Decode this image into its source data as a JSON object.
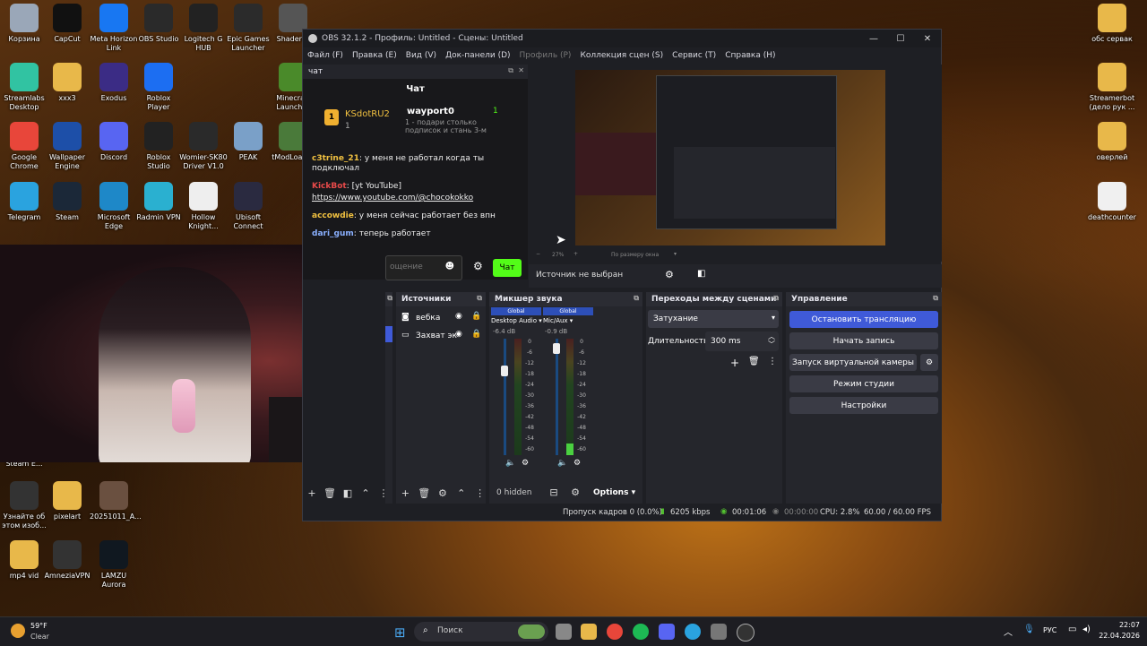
{
  "desktop": {
    "icons_left": [
      {
        "label": "Корзина",
        "icon": "recycle-bin-icon",
        "color": "#9aa7b8"
      },
      {
        "label": "CapCut",
        "icon": "capcut-icon",
        "color": "#111111"
      },
      {
        "label": "Meta Horizon Link",
        "icon": "meta-icon",
        "color": "#1877f2"
      },
      {
        "label": "OBS Studio",
        "icon": "obs-icon",
        "color": "#2a2a2a"
      },
      {
        "label": "Logitech G HUB",
        "icon": "logitech-icon",
        "color": "#222222"
      },
      {
        "label": "Epic Games Launcher",
        "icon": "epic-icon",
        "color": "#2b2b2b"
      },
      {
        "label": "ShaderGl",
        "icon": "shader-icon",
        "color": "#555555"
      },
      {
        "label": "Streamlabs Desktop",
        "icon": "streamlabs-icon",
        "color": "#31c3a2"
      },
      {
        "label": "xxx3",
        "icon": "folder-icon",
        "color": "#e8b84a"
      },
      {
        "label": "Exodus",
        "icon": "exodus-icon",
        "color": "#3b2c85"
      },
      {
        "label": "Roblox Player",
        "icon": "roblox-icon",
        "color": "#1c6ef2"
      },
      {
        "label": "Minecraft Launcher",
        "icon": "minecraft-icon",
        "color": "#4a8a2a"
      },
      {
        "label": "Google Chrome",
        "icon": "chrome-icon",
        "color": "#e8463a"
      },
      {
        "label": "Wallpaper Engine",
        "icon": "wallpaper-engine-icon",
        "color": "#1d4fa8"
      },
      {
        "label": "Discord",
        "icon": "discord-icon",
        "color": "#5865f2"
      },
      {
        "label": "Roblox Studio",
        "icon": "roblox-studio-icon",
        "color": "#222222"
      },
      {
        "label": "Womier-SK80 Driver V1.0",
        "icon": "womier-icon",
        "color": "#2a2a2a"
      },
      {
        "label": "PEAK",
        "icon": "peak-icon",
        "color": "#7aa0c8"
      },
      {
        "label": "tModLoader",
        "icon": "tmodloader-icon",
        "color": "#4a7a3a"
      },
      {
        "label": "Telegram",
        "icon": "telegram-icon",
        "color": "#2aa3df"
      },
      {
        "label": "Steam",
        "icon": "steam-icon",
        "color": "#1b2838"
      },
      {
        "label": "Microsoft Edge",
        "icon": "edge-icon",
        "color": "#1e88c8"
      },
      {
        "label": "Radmin VPN",
        "icon": "radmin-icon",
        "color": "#2ab0d0"
      },
      {
        "label": "Hollow Knight...",
        "icon": "hollow-knight-icon",
        "color": "#eeeeee"
      },
      {
        "label": "Ubisoft Connect",
        "icon": "ubisoft-icon",
        "color": "#2a2a40"
      },
      {
        "label": "Steam E...",
        "icon": "steam-e-icon",
        "color": "#1b2838"
      },
      {
        "label": "Узнайте об этом изоб...",
        "icon": "spotlight-icon",
        "color": "#333333"
      },
      {
        "label": "pixelart",
        "icon": "folder-icon",
        "color": "#e8b84a"
      },
      {
        "label": "20251011_A...",
        "icon": "image-file-icon",
        "color": "#6a5040"
      },
      {
        "label": "mp4 vid",
        "icon": "folder-icon",
        "color": "#e8b84a"
      },
      {
        "label": "AmneziaVPN",
        "icon": "amnezia-icon",
        "color": "#333333"
      },
      {
        "label": "LAMZU Aurora",
        "icon": "lamzu-icon",
        "color": "#101820"
      }
    ],
    "icons_right": [
      {
        "label": "обс сервак",
        "icon": "folder-icon",
        "color": "#e8b84a"
      },
      {
        "label": "Streamerbot (дело рук ...",
        "icon": "folder-icon",
        "color": "#e8b84a"
      },
      {
        "label": "оверлей",
        "icon": "folder-icon",
        "color": "#e8b84a"
      },
      {
        "label": "deathcounter",
        "icon": "text-file-icon",
        "color": "#f0f0f0"
      }
    ]
  },
  "obs": {
    "title": "OBS 32.1.2 - Профиль: Untitled - Сцены: Untitled",
    "menu": [
      "Файл (F)",
      "Правка (E)",
      "Вид (V)",
      "Док-панели (D)",
      "Профиль (P)",
      "Коллекция сцен (S)",
      "Сервис (T)",
      "Справка (H)"
    ],
    "chat": {
      "dock_title": "чат",
      "header": "Чат",
      "top_user": "KSdotRU2",
      "top_user_count": "1",
      "top_user2": "wayport0",
      "top_user2_count": "1",
      "gift_text": "1 - подари столько подписок и стань 3-м",
      "messages": [
        {
          "user": "c3trine_21",
          "user_color": "#f0c040",
          "text": "у меня не работал когда ты подключал"
        },
        {
          "user": "KickBot",
          "user_color": "#e84a4a",
          "text": "[yt YouTube]"
        },
        {
          "user": "",
          "user_color": "#ffffff",
          "text": "https://www.youtube.com/@chocokokko"
        },
        {
          "user": "accowdie",
          "user_color": "#f0c040",
          "text": "у меня сейчас работает без впн"
        },
        {
          "user": "dari_gum",
          "user_color": "#8ab0ff",
          "text": "теперь работает"
        }
      ],
      "input_placeholder": "ощение",
      "send_label": "Чат"
    },
    "preview": {
      "zoom": "27%",
      "fit_label": "По размеру окна",
      "no_source": "Источник не выбран"
    },
    "sources": {
      "title": "Источники",
      "items": [
        "вебка",
        "Захват эк"
      ]
    },
    "mixer": {
      "title": "Микшер звука",
      "channels": [
        {
          "tag": "Global",
          "name": "Desktop Audio",
          "db": "-6.4 dB",
          "level": 0.0
        },
        {
          "tag": "Global",
          "name": "Mic/Aux",
          "db": "-0.9 dB",
          "level": 0.1
        }
      ],
      "ticks": [
        "0",
        "-6",
        "-12",
        "-18",
        "-24",
        "-30",
        "-36",
        "-42",
        "-48",
        "-54",
        "-60"
      ],
      "hidden": "0 hidden",
      "options": "Options"
    },
    "transitions": {
      "title": "Переходы между сценами",
      "selected": "Затухание",
      "duration_label": "Длительность",
      "duration_value": "300 ms"
    },
    "controls": {
      "title": "Управление",
      "stop_stream": "Остановить трансляцию",
      "start_record": "Начать запись",
      "virtual_cam": "Запуск виртуальной камеры",
      "studio_mode": "Режим студии",
      "settings": "Настройки"
    },
    "status": {
      "dropped": "Пропуск кадров 0 (0.0%)",
      "bitrate": "6205 kbps",
      "stream_time": "00:01:06",
      "rec_time": "00:00:00",
      "cpu": "CPU: 2.8%",
      "fps": "60.00 / 60.00 FPS"
    }
  },
  "taskbar": {
    "weather_temp": "59°F",
    "weather_desc": "Clear",
    "search_placeholder": "Поиск",
    "lang": "РУС",
    "time": "22:07",
    "date": "22.04.2026"
  }
}
